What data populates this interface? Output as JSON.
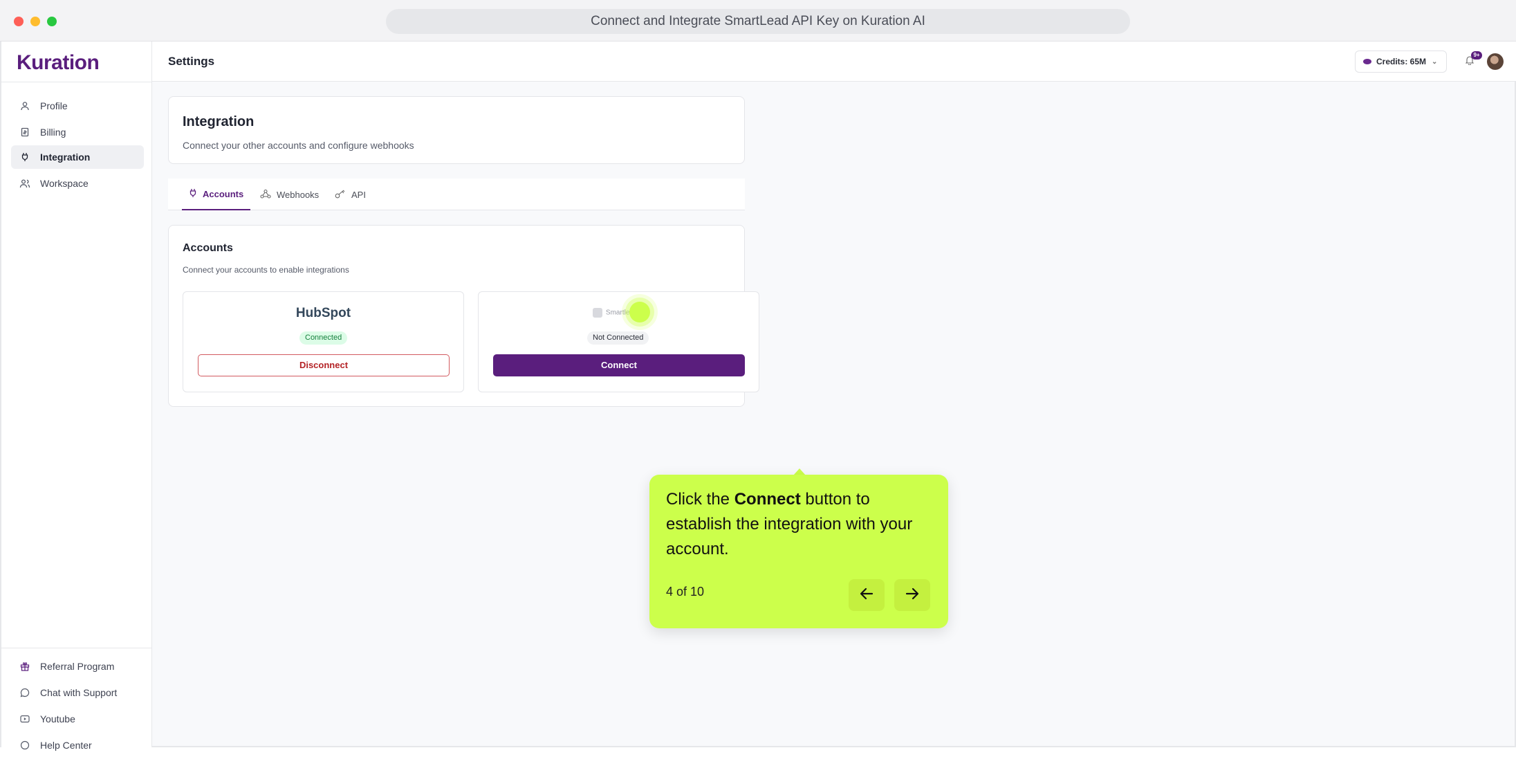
{
  "browser": {
    "title": "Connect and Integrate SmartLead API Key on Kuration AI"
  },
  "sidebar": {
    "logo": "Kuration",
    "items": [
      {
        "label": "Profile",
        "icon": "user-icon"
      },
      {
        "label": "Billing",
        "icon": "receipt-icon"
      },
      {
        "label": "Integration",
        "icon": "plug-icon",
        "active": true
      },
      {
        "label": "Workspace",
        "icon": "users-icon"
      }
    ],
    "bottom_items": [
      {
        "label": "Referral Program",
        "icon": "gift-icon"
      },
      {
        "label": "Chat with Support",
        "icon": "chat-icon"
      },
      {
        "label": "Youtube",
        "icon": "youtube-icon"
      },
      {
        "label": "Help Center",
        "icon": "help-icon"
      }
    ]
  },
  "topbar": {
    "title": "Settings",
    "credits": "Credits: 65M",
    "notification_badge": "9+"
  },
  "integration_card": {
    "title": "Integration",
    "subtitle": "Connect your other accounts and configure webhooks"
  },
  "tabs": [
    {
      "label": "Accounts",
      "icon": "plug-icon",
      "active": true
    },
    {
      "label": "Webhooks",
      "icon": "webhook-icon"
    },
    {
      "label": "API",
      "icon": "key-icon"
    }
  ],
  "accounts": {
    "title": "Accounts",
    "subtitle": "Connect your accounts to enable integrations",
    "integrations": [
      {
        "name": "HubSpot",
        "status": "Connected",
        "action": "Disconnect"
      },
      {
        "name": "Smartlead.ai",
        "status": "Not Connected",
        "action": "Connect"
      }
    ]
  },
  "tooltip": {
    "text_before": "Click the ",
    "text_bold": "Connect",
    "text_after": " button to establish the integration with your account.",
    "step": "4 of 10",
    "accent": "#ccff4b"
  },
  "colors": {
    "brand": "#5a1e7d",
    "connected": "#15803d",
    "disconnect": "#b42326"
  }
}
